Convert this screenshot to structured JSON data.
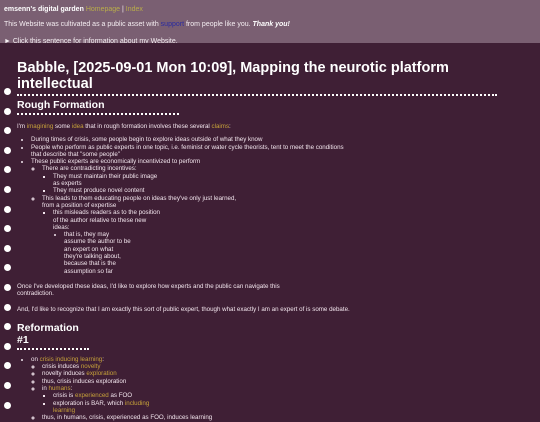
{
  "header": {
    "site_name": "emsenn's digital garden",
    "homepage_link": "Homepage",
    "separator": "|",
    "index_link": "Index",
    "cultivated_pre": "This Website was cultivated as a public asset with ",
    "support_link": "support",
    "cultivated_post": " from people like you. ",
    "thanks": "Thank you!",
    "info_toggle": "► Click this sentence for information about my Website."
  },
  "page": {
    "title": "Babble, [2025-09-01 Mon 10:09], Mapping the neurotic platform intellectual",
    "section1": {
      "heading": "Rough Formation",
      "intro": [
        {
          "t": "I'm ",
          "h": false
        },
        {
          "t": "imagining",
          "h": true
        },
        {
          "t": " some ",
          "h": false
        },
        {
          "t": "idea",
          "h": true
        },
        {
          "t": " that in rough formation involves these several ",
          "h": false
        },
        {
          "t": "claims",
          "h": true
        },
        {
          "t": ":",
          "h": false
        }
      ],
      "b1": "During times of crisis, some people begin to explore ideas outside of what they know",
      "b2": "People who perform as public experts in one topic, i.e. feminist or water cycle theorists, tent to meet the conditions that describe that \"some people\"",
      "b3": "These public experts are economically incentivized to perform",
      "b3_1": "There are contradicting incentives:",
      "b3_1_1": "They must maintain their public image as experts",
      "b3_1_2": "They must produce novel content",
      "b3_2": "This leads to them educating people on ideas they've only just learned, from a position of expertise",
      "b3_2_1": "this misleads readers as to the position of the author relative to these new ideas:",
      "b3_2_1_1": "that is, they may assume the author to be an expert on what they're talking about, because that is the assumption so far",
      "para1": "Once I've developed these ideas, I'd like to explore how experts and the public can navigate this contradiction.",
      "para2": "And, I'd like to recognize that I am exactly this sort of public expert, though what exactly I am an expert of is some debate."
    },
    "section2": {
      "heading": "Reformation #1",
      "r1_pre": "on ",
      "r1_link": "crisis inducing learning",
      "r1_post": ":",
      "r1_1_pre": "crisis induces ",
      "r1_1_link": "novelty",
      "r1_2_pre": "novelty induces ",
      "r1_2_link": "exploration",
      "r1_3": "thus, crisis induces exploration",
      "r1_4_pre": "in ",
      "r1_4_link": "humans",
      "r1_4_post": ":",
      "r1_4_1_pre": "crisis is ",
      "r1_4_1_link": "experienced",
      "r1_4_1_post": " as FOO",
      "r1_4_2_pre": "exploration is BAR, which ",
      "r1_4_2_link": "including",
      "r1_4_2_link2": "learning",
      "r1_5": "thus, in humans, crisis, experienced as FOO, induces learning"
    }
  },
  "colors": {
    "header_bg": "#7a5f72",
    "page_bg": "#3f1f35",
    "link": "#c7a23a",
    "text": "#f3e6ee"
  }
}
